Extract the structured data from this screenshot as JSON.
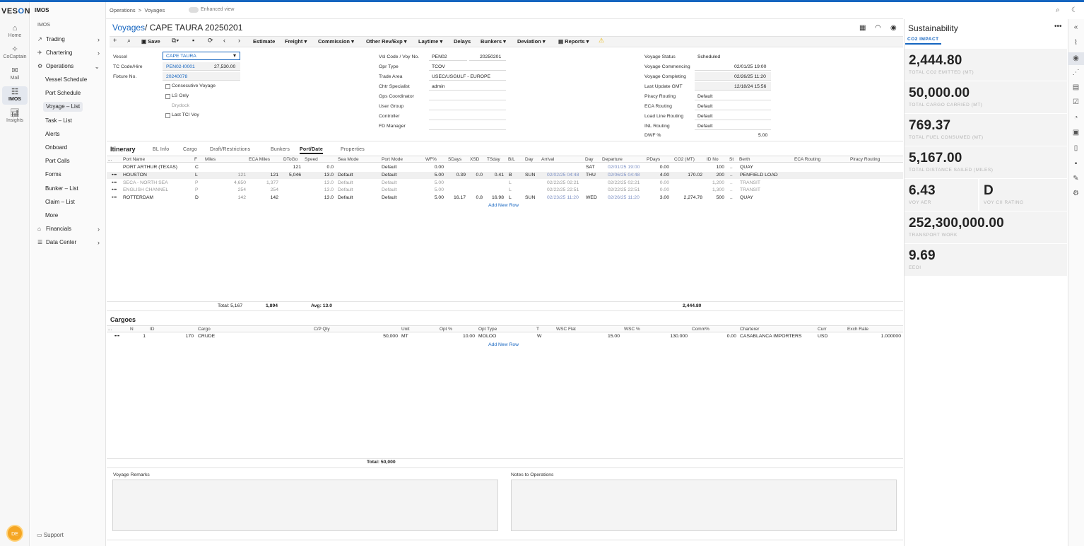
{
  "app": {
    "logo_pre": "VES",
    "logo_o": "O",
    "logo_post": "N",
    "product": "IMOS",
    "product_sub": "IMOS"
  },
  "rail": [
    {
      "label": "Home",
      "icon": "home-icon"
    },
    {
      "label": "CoCaptain",
      "icon": "cocaptain-icon"
    },
    {
      "label": "Mail",
      "icon": "mail-icon"
    },
    {
      "label": "IMOS",
      "icon": "imos-icon"
    },
    {
      "label": "Insights",
      "icon": "insights-icon"
    }
  ],
  "avatar": "DE",
  "nav": {
    "trading": "Trading",
    "chartering": "Chartering",
    "operations": "Operations",
    "sub": [
      "Vessel Schedule",
      "Port Schedule",
      "Voyage – List",
      "Task – List",
      "Alerts",
      "Onboard",
      "Port Calls",
      "Forms",
      "Bunker – List",
      "Claim – List",
      "More"
    ],
    "financials": "Financials",
    "data_center": "Data Center",
    "support": "Support"
  },
  "breadcrumb": {
    "a": "Operations",
    "sep": ">",
    "b": "Voyages",
    "toggle_label": "Enhanced view"
  },
  "title": {
    "link": "Voyages",
    "slash": "/",
    "name": "CAPE TAURA 20250201"
  },
  "toolbar": {
    "save": "Save",
    "estimate": "Estimate",
    "freight": "Freight",
    "commission": "Commission",
    "other": "Other Rev/Exp",
    "laytime": "Laytime",
    "delays": "Delays",
    "bunkers": "Bunkers",
    "deviation": "Deviation",
    "reports": "Reports"
  },
  "form": {
    "vessel_l": "Vessel",
    "vessel_v": "CAPE TAURA",
    "tc_l": "TC Code/Hire",
    "tc_v": "PEN02-I0001",
    "tc_hire": "27,530.00",
    "fixture_l": "Fixture No.",
    "fixture_v": "20240078",
    "consecutive": "Consecutive Voyage",
    "ls_only": "LS Only",
    "drydock": "Drydock",
    "last_tci": "Last TCI Voy",
    "vsl_code_l": "Vsl Code / Voy No.",
    "vsl_code_v": "PEN02",
    "voy_no_v": "20250201",
    "opr_type_l": "Opr Type",
    "opr_type_v": "TCOV",
    "trade_area_l": "Trade Area",
    "trade_area_v": "USEC/USGULF - EUROPE",
    "chtr_l": "Chtr Specialist",
    "chtr_v": "admin",
    "ops_coord_l": "Ops Coordinator",
    "user_group_l": "User Group",
    "controller_l": "Controller",
    "fd_manager_l": "FD Manager",
    "status_l": "Voyage Status",
    "status_v": "Scheduled",
    "commencing_l": "Voyage Commencing",
    "commencing_v": "02/01/25 19:00",
    "completing_l": "Voyage Completing",
    "completing_v": "02/26/25 11:20",
    "last_update_l": "Last Update GMT",
    "last_update_v": "12/18/24 15:56",
    "piracy_l": "Piracy Routing",
    "piracy_v": "Default",
    "eca_l": "ECA Routing",
    "eca_v": "Default",
    "loadline_l": "Load Line Routing",
    "loadline_v": "Default",
    "inl_l": "INL Routing",
    "inl_v": "Default",
    "dwf_l": "DWF %",
    "dwf_v": "5.00"
  },
  "itinerary": {
    "title": "Itinerary",
    "tabs": [
      "BL Info",
      "Cargo",
      "Draft/Restrictions",
      "Bunkers",
      "Port/Date",
      "Properties"
    ],
    "headers": [
      "...",
      "Port Name",
      "F",
      "Miles",
      "ECA Miles",
      "DToGo",
      "Speed",
      "Sea Mode",
      "Port Mode",
      "WF%",
      "SDays",
      "XSD",
      "TSday",
      "B/L",
      "Day",
      "Arrival",
      "Day",
      "Departure",
      "PDays",
      "CO2 (MT)",
      "ID No",
      "St",
      "Berth",
      "ECA Routing",
      "Piracy Routing"
    ],
    "rows": [
      {
        "dots": "",
        "port": "PORT ARTHUR (TEXAS)",
        "f": "C",
        "miles": "",
        "eca": "",
        "dtogo": "121",
        "speed": "0.0",
        "sea": "",
        "portmode": "Default",
        "wf": "0.00",
        "sdays": "",
        "xsd": "",
        "tsday": "",
        "bl": "",
        "day": "",
        "arrival": "",
        "day2": "SAT",
        "departure": "02/01/25 19:00",
        "pdays": "0.00",
        "co2": "",
        "id": "100",
        "st": "..",
        "berth": "QUAY"
      },
      {
        "dots": "•••",
        "port": "HOUSTON",
        "f": "L",
        "miles": "121",
        "eca": "121",
        "dtogo": "5,046",
        "speed": "13.0",
        "sea": "Default",
        "portmode": "Default",
        "wf": "5.00",
        "sdays": "0.39",
        "xsd": "0.0",
        "tsday": "0.41",
        "bl": "B",
        "day": "SUN",
        "arrival": "02/02/25 04:48",
        "day2": "THU",
        "departure": "02/06/25 04:48",
        "pdays": "4.00",
        "co2": "170.02",
        "id": "200",
        "st": "..",
        "berth": "PENFIELD LOAD"
      },
      {
        "dots": "•••",
        "port": "SECA - NORTH SEA",
        "f": "P",
        "miles": "4,650",
        "eca": "1,377",
        "dtogo": "",
        "speed": "13.0",
        "sea": "Default",
        "portmode": "Default",
        "wf": "5.00",
        "sdays": "",
        "xsd": "",
        "tsday": "",
        "bl": "L",
        "day": "",
        "arrival": "02/22/25 02:21",
        "day2": "",
        "departure": "02/22/25 02:21",
        "pdays": "0.00",
        "co2": "",
        "id": "1,200",
        "st": "..",
        "berth": "TRANSIT"
      },
      {
        "dots": "•••",
        "port": "ENGLISH CHANNEL",
        "f": "P",
        "miles": "254",
        "eca": "254",
        "dtogo": "",
        "speed": "13.0",
        "sea": "Default",
        "portmode": "Default",
        "wf": "5.00",
        "sdays": "",
        "xsd": "",
        "tsday": "",
        "bl": "L",
        "day": "",
        "arrival": "02/22/25 22:51",
        "day2": "",
        "departure": "02/22/25 22:51",
        "pdays": "0.00",
        "co2": "",
        "id": "1,300",
        "st": "..",
        "berth": "TRANSIT"
      },
      {
        "dots": "•••",
        "port": "ROTTERDAM",
        "f": "D",
        "miles": "142",
        "eca": "142",
        "dtogo": "",
        "speed": "13.0",
        "sea": "Default",
        "portmode": "Default",
        "wf": "5.00",
        "sdays": "16.17",
        "xsd": "0.8",
        "tsday": "16.98",
        "bl": "L",
        "day": "SUN",
        "arrival": "02/23/25 11:20",
        "day2": "WED",
        "departure": "02/26/25 11:20",
        "pdays": "3.00",
        "co2": "2,274.78",
        "id": "500",
        "st": "..",
        "berth": "QUAY"
      }
    ],
    "add_row": "Add New Row",
    "total_miles": "Total: 5,167",
    "total_eca": "1,894",
    "avg": "Avg: 13.0",
    "total_co2": "2,444.80"
  },
  "cargoes": {
    "title": "Cargoes",
    "headers": [
      "...",
      "N",
      "ID",
      "Cargo",
      "C/P Qty",
      "Unit",
      "Opt %",
      "Opt Type",
      "T",
      "WSC Flat",
      "WSC %",
      "Comm%",
      "Charterer",
      "Curr",
      "Exch Rate"
    ],
    "rows": [
      {
        "dots": "•••",
        "n": "1",
        "id": "170",
        "cargo": "CRUDE",
        "qty": "50,000",
        "unit": "MT",
        "opt": "10.00",
        "opttype": "MOLOO",
        "t": "W",
        "wscflat": "15.00",
        "wscpct": "130.000",
        "comm": "0.00",
        "charterer": "CASABLANCA IMPORTERS",
        "curr": "USD",
        "exch": "1.000000"
      }
    ],
    "add_row": "Add New Row",
    "total": "Total: 50,000"
  },
  "remarks": {
    "voyage": "Voyage Remarks",
    "notes": "Notes to Operations"
  },
  "sustainability": {
    "title": "Sustainability",
    "menu": "•••",
    "tab": "CO2 IMPACT",
    "metrics": [
      {
        "value": "2,444.80",
        "label": "TOTAL CO2 EMITTED (MT)"
      },
      {
        "value": "50,000.00",
        "label": "TOTAL CARGO CARRIED (MT)"
      },
      {
        "value": "769.37",
        "label": "TOTAL FUEL CONSUMED (MT)"
      },
      {
        "value": "5,167.00",
        "label": "TOTAL DISTANCE SAILED (MILES)"
      },
      {
        "value": "6.43",
        "label": "VOY AER"
      },
      {
        "value": "D",
        "label": "VOY CII RATING"
      },
      {
        "value": "252,300,000.00",
        "label": "TRANSPORT WORK"
      },
      {
        "value": "9.69",
        "label": "EEOI"
      }
    ]
  },
  "icons": {
    "search": "⌕",
    "moon": "☾",
    "grid": "▦",
    "gauge": "◠",
    "globe": "◉",
    "plus": "+",
    "copy": "⧉",
    "trash": "▪",
    "refresh": "⟳",
    "prev": "‹",
    "next": "›",
    "warn": "⚠",
    "collapse": "«",
    "chev_r": "›",
    "chev_d": "⌄"
  },
  "colors": {
    "accent": "#1565c0",
    "warn": "#f5c400"
  }
}
